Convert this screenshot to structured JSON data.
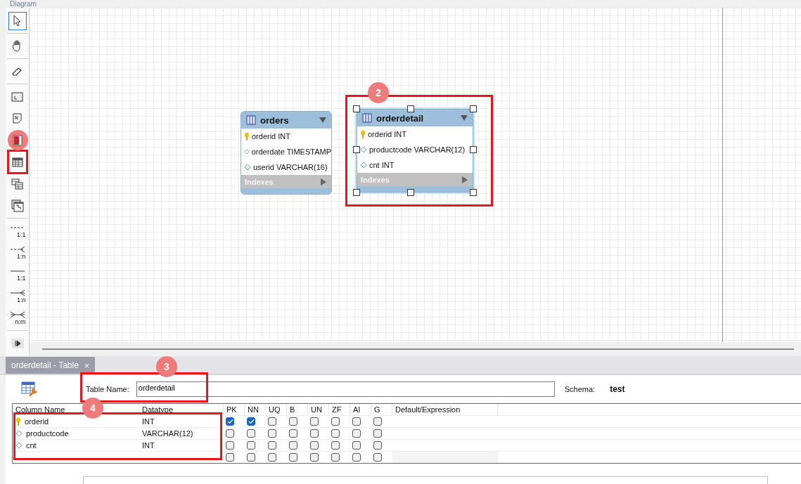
{
  "panel_title": "Diagram",
  "toolbar": [
    {
      "tools": [
        {
          "kind": "pointer",
          "selected": true,
          "highlight": false,
          "marked": false
        }
      ]
    },
    {
      "tools": [
        {
          "kind": "hand",
          "selected": false,
          "highlight": false,
          "marked": false
        }
      ]
    },
    {
      "tools": [
        {
          "kind": "eraser",
          "selected": false,
          "highlight": false,
          "marked": false
        }
      ]
    },
    {
      "tools": [
        {
          "kind": "layer",
          "selected": false,
          "highlight": false,
          "marked": false
        },
        {
          "kind": "note",
          "selected": false,
          "highlight": false,
          "marked": false
        },
        {
          "kind": "image",
          "selected": false,
          "highlight": false,
          "marked": true
        },
        {
          "kind": "table",
          "selected": false,
          "highlight": true,
          "marked": false
        },
        {
          "kind": "view",
          "selected": false,
          "highlight": false,
          "marked": false
        },
        {
          "kind": "routine",
          "selected": false,
          "highlight": false,
          "marked": false
        }
      ]
    },
    {
      "tools": [
        {
          "kind": "onetoone",
          "label": "1:1",
          "dashed": true,
          "selected": false,
          "highlight": false,
          "marked": false
        },
        {
          "kind": "onetomany",
          "label": "1:n",
          "dashed": true,
          "selected": false,
          "highlight": false,
          "marked": false
        },
        {
          "kind": "onetoone",
          "label": "1:1",
          "dashed": false,
          "selected": false,
          "highlight": false,
          "marked": false
        },
        {
          "kind": "onetomany",
          "label": "1:n",
          "dashed": false,
          "selected": false,
          "highlight": false,
          "marked": false
        },
        {
          "kind": "manytomany",
          "label": "n:m",
          "dashed": false,
          "selected": false,
          "highlight": false,
          "marked": false
        }
      ]
    }
  ],
  "diagram": {
    "tables": [
      {
        "name": "orders",
        "selected": false,
        "highlight": false,
        "columns": [
          {
            "kind": "key",
            "text": "orderid INT"
          },
          {
            "kind": "column",
            "text": "orderdate TIMESTAMP"
          },
          {
            "kind": "column",
            "text": "userid VARCHAR(16)"
          }
        ],
        "indexes": "Indexes"
      },
      {
        "name": "orderdetail",
        "selected": true,
        "highlight": true,
        "marker": "2",
        "columns": [
          {
            "kind": "key",
            "text": "orderid INT"
          },
          {
            "kind": "column",
            "text": "productcode VARCHAR(12)"
          },
          {
            "kind": "column",
            "text": "cnt INT"
          }
        ],
        "indexes": "Indexes"
      }
    ]
  },
  "editor": {
    "tab": {
      "label": "orderdetail - Table",
      "close": "×",
      "selected": true
    },
    "table_name": {
      "label": "Table Name:",
      "value": "orderdetail",
      "highlight": true,
      "marker": "3"
    },
    "schema": {
      "label": "Schema:",
      "value": "test"
    },
    "grid": {
      "columns": [
        "Column Name",
        "Datatype",
        "PK",
        "NN",
        "UQ",
        "B",
        "UN",
        "ZF",
        "AI",
        "G",
        "Default/Expression"
      ],
      "highlight": true,
      "marker": "4",
      "rows": [
        {
          "kind": "key",
          "name": "orderid",
          "datatype": "INT",
          "flags": [
            {
              "checked": true
            },
            {
              "checked": true
            },
            {
              "checked": false
            },
            {
              "checked": false
            },
            {
              "checked": false
            },
            {
              "checked": false
            },
            {
              "checked": false
            },
            {
              "checked": false
            }
          ]
        },
        {
          "kind": "column",
          "name": "productcode",
          "datatype": "VARCHAR(12)",
          "flags": [
            {
              "checked": false
            },
            {
              "checked": false
            },
            {
              "checked": false
            },
            {
              "checked": false
            },
            {
              "checked": false
            },
            {
              "checked": false
            },
            {
              "checked": false
            },
            {
              "checked": false
            }
          ]
        },
        {
          "kind": "column",
          "name": "cnt",
          "datatype": "INT",
          "flags": [
            {
              "checked": false
            },
            {
              "checked": false
            },
            {
              "checked": false
            },
            {
              "checked": false
            },
            {
              "checked": false
            },
            {
              "checked": false
            },
            {
              "checked": false
            },
            {
              "checked": false
            }
          ]
        },
        {
          "kind": "empty",
          "flags": [
            {
              "checked": false
            },
            {
              "checked": false
            },
            {
              "checked": false
            },
            {
              "checked": false
            },
            {
              "checked": false
            },
            {
              "checked": false
            },
            {
              "checked": false
            },
            {
              "checked": false
            }
          ]
        }
      ]
    }
  }
}
